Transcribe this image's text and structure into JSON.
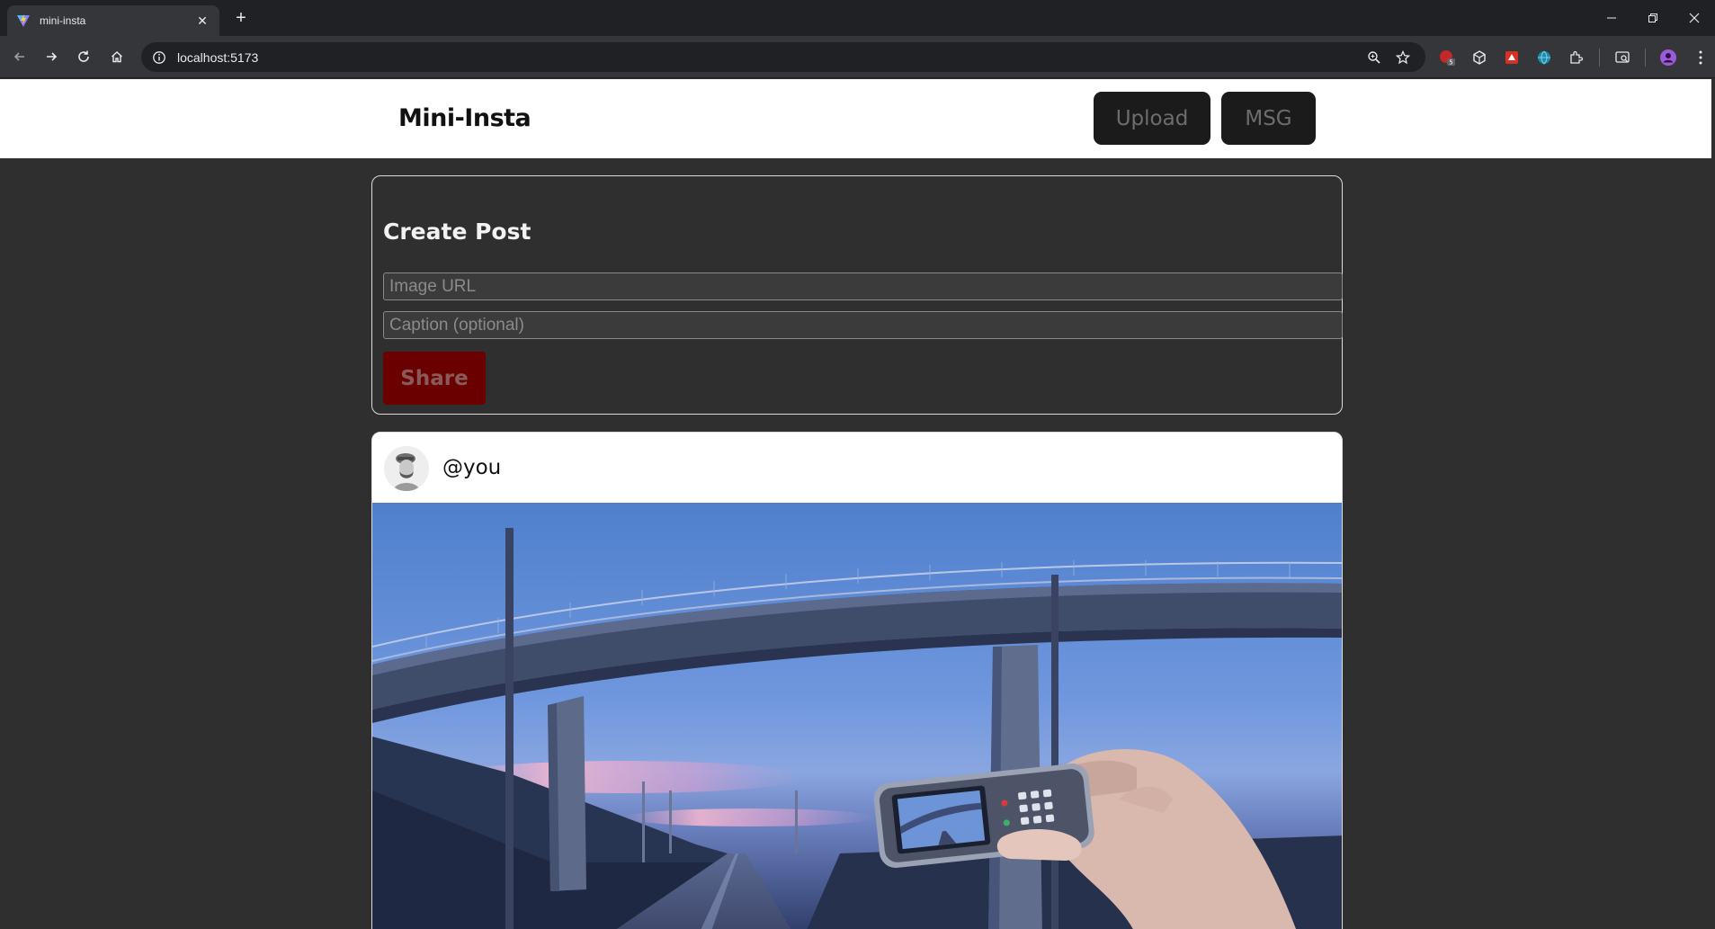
{
  "browser": {
    "tab_title": "mini-insta",
    "url": "localhost:5173",
    "new_tab_symbol": "+",
    "close_symbol": "✕"
  },
  "app": {
    "brand": "Mini-Insta",
    "nav": {
      "upload_label": "Upload",
      "msg_label": "MSG"
    }
  },
  "create_post": {
    "title": "Create Post",
    "image_url_placeholder": "Image URL",
    "caption_placeholder": "Caption (optional)",
    "share_label": "Share"
  },
  "feed": {
    "posts": [
      {
        "username": "@you",
        "image_description_icon": "bridge-photo"
      }
    ]
  },
  "colors": {
    "page_bg": "#2f2f2f",
    "header_bg": "#ffffff",
    "nav_button_bg": "#1b1b1b",
    "share_button_bg": "#6b0000"
  }
}
